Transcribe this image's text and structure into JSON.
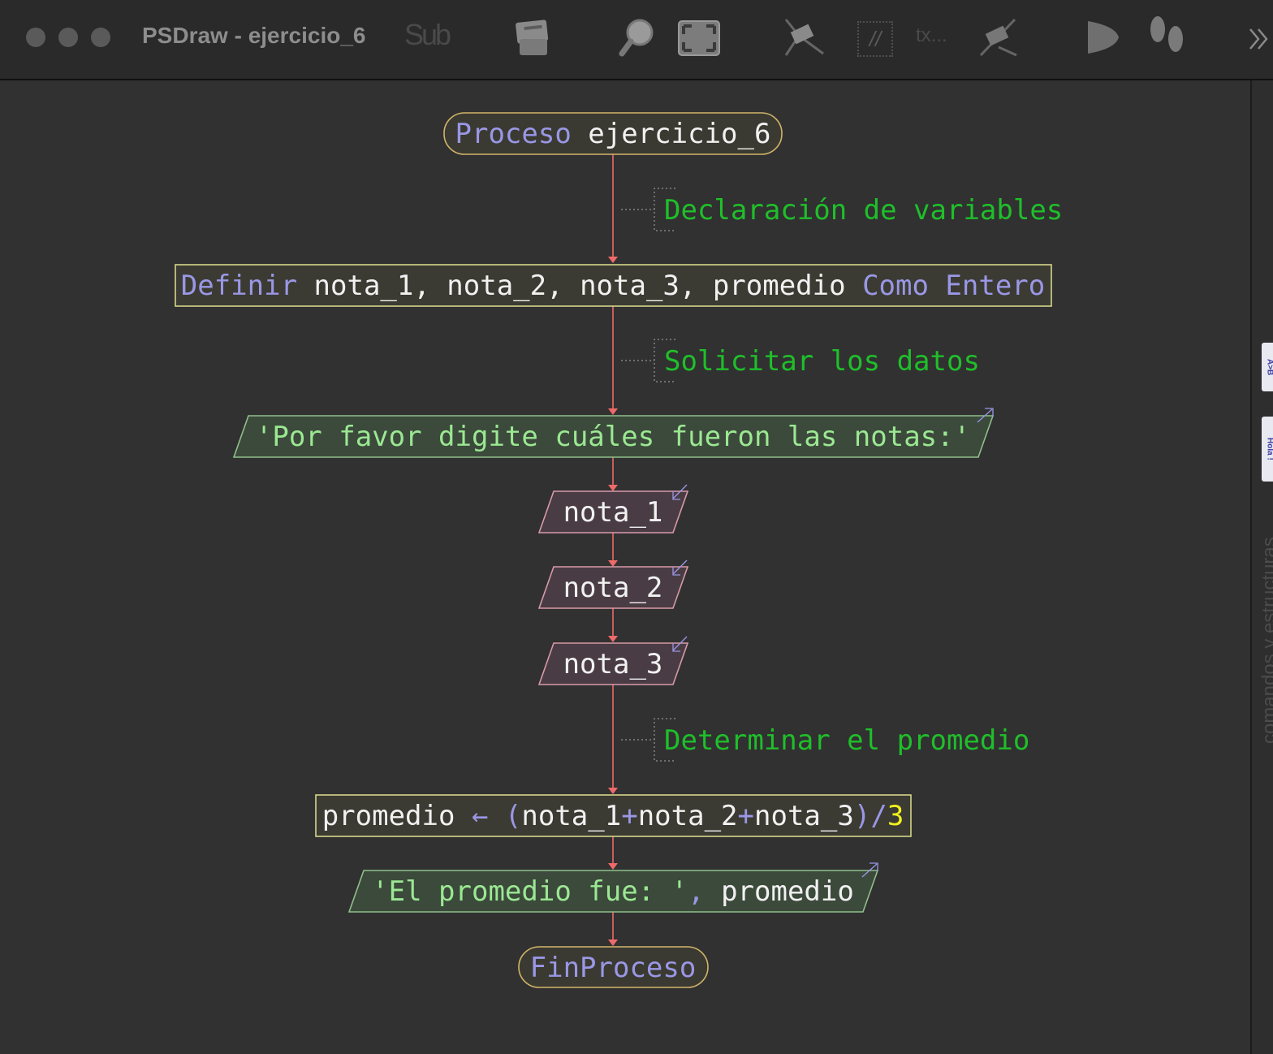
{
  "window": {
    "title": "PSDraw - ejercicio_6"
  },
  "toolbar": {
    "sub_label": "Sub",
    "comment_label": "//",
    "text_label": "tx..."
  },
  "right_panel": {
    "label": "comandos y estructuras",
    "tab_1": "A>B",
    "tab_2": "Hola !"
  },
  "flow": {
    "start_kw": "Proceso",
    "start_name": "ejercicio_6",
    "comment_1": "Declaración de variables",
    "def_kw1": "Definir",
    "def_vars": "nota_1, nota_2, nota_3, promedio",
    "def_kw2": "Como Entero",
    "comment_2": "Solicitar los datos",
    "write_1": "'Por favor digite cuáles fueron las notas:'",
    "read_1": "nota_1",
    "read_2": "nota_2",
    "read_3": "nota_3",
    "comment_3": "Determinar el promedio",
    "assign": "promedio ← (nota_1+nota_2+nota_3)/3",
    "write_2_str": "'El promedio fue: '",
    "write_2_sep": ",",
    "write_2_var": "promedio",
    "end": "FinProceso"
  },
  "colors": {
    "keyword": "#9a97e6",
    "identifier": "#f1f1f1",
    "comment": "#1fbf2a",
    "string": "#9be892",
    "number": "#f2f01e",
    "connector": "#f06a6a",
    "terminal_border": "#d2b46a",
    "process_border": "#d6d68a",
    "output_border": "#8fbf8a",
    "input_border": "#d79aa8"
  }
}
